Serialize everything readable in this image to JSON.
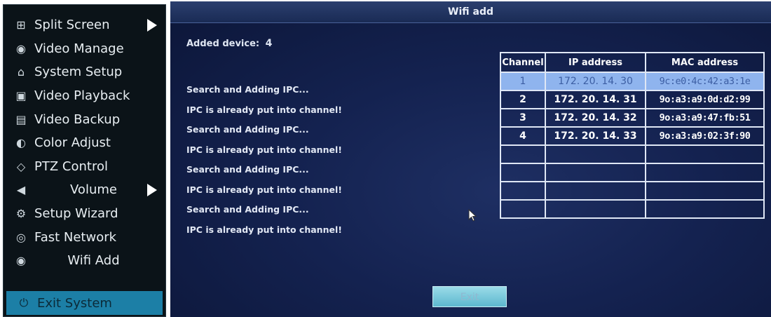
{
  "menu": {
    "items": [
      {
        "label": "Split Screen",
        "icon": "grid-icon",
        "glyph": "⊞",
        "submenu": true
      },
      {
        "label": "Video Manage",
        "icon": "camera-icon",
        "glyph": "◉",
        "submenu": false
      },
      {
        "label": "System Setup",
        "icon": "home-icon",
        "glyph": "⌂",
        "submenu": false
      },
      {
        "label": "Video Playback",
        "icon": "film-icon",
        "glyph": "▣",
        "submenu": false
      },
      {
        "label": "Video Backup",
        "icon": "floppy-icon",
        "glyph": "▤",
        "submenu": false
      },
      {
        "label": "Color Adjust",
        "icon": "palette-icon",
        "glyph": "◐",
        "submenu": false
      },
      {
        "label": "PTZ Control",
        "icon": "diamond-icon",
        "glyph": "◇",
        "submenu": false
      },
      {
        "label": "Volume",
        "icon": "speaker-icon",
        "glyph": "◀",
        "submenu": true
      },
      {
        "label": "Setup Wizard",
        "icon": "gears-icon",
        "glyph": "⚙",
        "submenu": false
      },
      {
        "label": "Fast Network",
        "icon": "globe-icon",
        "glyph": "◎",
        "submenu": false
      },
      {
        "label": "Wifi Add",
        "icon": "camera-icon",
        "glyph": "◉",
        "submenu": false
      }
    ],
    "exit": {
      "label": "Exit System",
      "icon": "power-icon",
      "glyph": "⏻"
    }
  },
  "dialog": {
    "title": "Wifi add",
    "added_label": "Added device:",
    "added_count": "4",
    "log": [
      "Search and Adding IPC...",
      "IPC is already put into channel!",
      "Search and Adding IPC...",
      "IPC is already put into channel!",
      "Search and Adding IPC...",
      "IPC is already put into channel!",
      "Search and Adding IPC...",
      "IPC is already put into channel!"
    ],
    "table": {
      "headers": [
        "Channel",
        "IP address",
        "MAC address"
      ],
      "rows": [
        {
          "channel": "1",
          "ip": "172. 20. 14. 30",
          "mac": "9c:e0:4c:42:a3:1e",
          "selected": true
        },
        {
          "channel": "2",
          "ip": "172. 20. 14. 31",
          "mac": "9o:a3:a9:0d:d2:99",
          "selected": false
        },
        {
          "channel": "3",
          "ip": "172. 20. 14. 32",
          "mac": "9o:a3:a9:47:fb:51",
          "selected": false
        },
        {
          "channel": "4",
          "ip": "172. 20. 14. 33",
          "mac": "9o:a3:a9:02:3f:90",
          "selected": false
        },
        {
          "channel": "",
          "ip": "",
          "mac": "",
          "selected": false
        },
        {
          "channel": "",
          "ip": "",
          "mac": "",
          "selected": false
        },
        {
          "channel": "",
          "ip": "",
          "mac": "",
          "selected": false
        },
        {
          "channel": "",
          "ip": "",
          "mac": "",
          "selected": false
        }
      ]
    },
    "exit_button": "Exit"
  },
  "colors": {
    "menu_bg": "#0b1318",
    "menu_highlight": "#1c7fa6",
    "dialog_bg": "#142250",
    "selected_row": "#8fb4ee",
    "exit_button": "#7ccbe0"
  }
}
